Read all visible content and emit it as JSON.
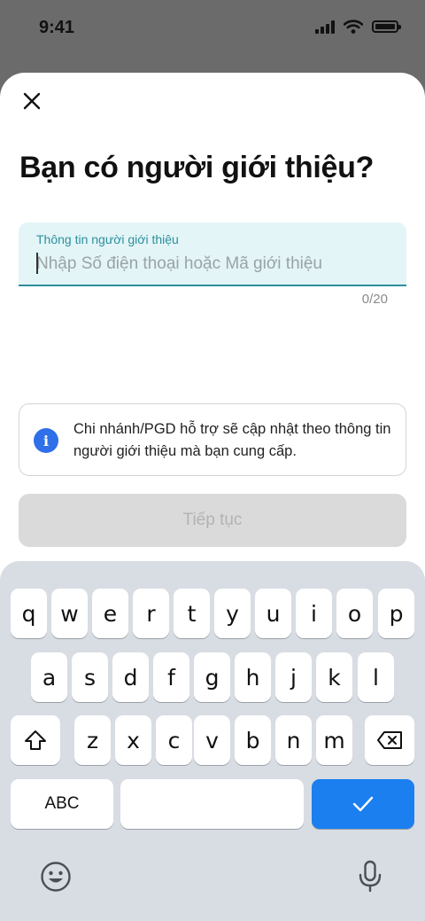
{
  "status_bar": {
    "time": "9:41"
  },
  "sheet": {
    "title": "Bạn có người giới thiệu?",
    "field": {
      "label": "Thông tin người giới thiệu",
      "placeholder": "Nhập Số điện thoại hoặc Mã giới thiệu",
      "value": "",
      "counter": "0/20"
    },
    "info": {
      "icon": "info-icon",
      "text": "Chi nhánh/PGD hỗ trợ sẽ cập nhật theo thông tin người giới thiệu mà bạn cung cấp."
    },
    "continue_label": "Tiếp tục"
  },
  "keyboard": {
    "row1": [
      "q",
      "w",
      "e",
      "r",
      "t",
      "y",
      "u",
      "i",
      "o",
      "p"
    ],
    "row2": [
      "a",
      "s",
      "d",
      "f",
      "g",
      "h",
      "j",
      "k",
      "l"
    ],
    "row3": [
      "z",
      "x",
      "c",
      "v",
      "b",
      "n",
      "m"
    ],
    "abc_label": "ABC",
    "done_icon": "checkmark-icon",
    "shift_icon": "shift-icon",
    "delete_icon": "backspace-icon",
    "emoji_icon": "emoji-icon",
    "mic_icon": "microphone-icon"
  },
  "colors": {
    "accent": "#2c8f9c",
    "field_bg": "#e3f5f7",
    "info_icon": "#2f6fe8",
    "done_key": "#1b7ff0",
    "disabled_button": "#dadada"
  }
}
